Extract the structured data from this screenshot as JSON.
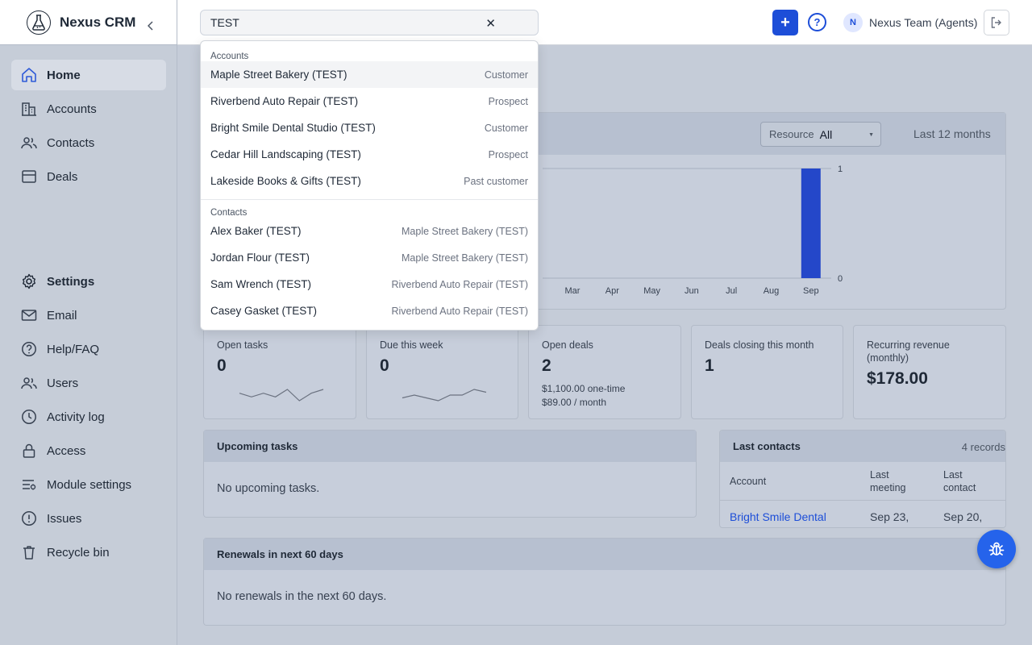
{
  "app": {
    "name": "Nexus CRM"
  },
  "topbar": {
    "search_value": "TEST",
    "clear_glyph": "✕",
    "add_glyph": "+",
    "help_glyph": "?",
    "user_initial": "N",
    "user_name": "Nexus Team (Agents)"
  },
  "sidebar": {
    "main": [
      {
        "label": "Home",
        "icon": "home-icon"
      },
      {
        "label": "Accounts",
        "icon": "building-icon"
      },
      {
        "label": "Contacts",
        "icon": "users-icon"
      },
      {
        "label": "Deals",
        "icon": "deal-icon"
      }
    ],
    "settings_label": "Settings",
    "settings": [
      {
        "label": "Email",
        "icon": "mail-icon"
      },
      {
        "label": "Help/FAQ",
        "icon": "help-icon"
      },
      {
        "label": "Users",
        "icon": "users-icon"
      },
      {
        "label": "Activity log",
        "icon": "clock-icon"
      },
      {
        "label": "Access",
        "icon": "lock-icon"
      },
      {
        "label": "Module settings",
        "icon": "sliders-icon"
      },
      {
        "label": "Issues",
        "icon": "alert-icon"
      },
      {
        "label": "Recycle bin",
        "icon": "trash-icon"
      }
    ]
  },
  "search_results": {
    "accounts_heading": "Accounts",
    "accounts": [
      {
        "name": "Maple Street Bakery (TEST)",
        "status": "Customer"
      },
      {
        "name": "Riverbend Auto Repair (TEST)",
        "status": "Prospect"
      },
      {
        "name": "Bright Smile Dental Studio (TEST)",
        "status": "Customer"
      },
      {
        "name": "Cedar Hill Landscaping (TEST)",
        "status": "Prospect"
      },
      {
        "name": "Lakeside Books & Gifts (TEST)",
        "status": "Past customer"
      }
    ],
    "contacts_heading": "Contacts",
    "contacts": [
      {
        "name": "Alex Baker (TEST)",
        "account": "Maple Street Bakery (TEST)"
      },
      {
        "name": "Jordan Flour (TEST)",
        "account": "Maple Street Bakery (TEST)"
      },
      {
        "name": "Sam Wrench (TEST)",
        "account": "Riverbend Auto Repair (TEST)"
      },
      {
        "name": "Casey Gasket (TEST)",
        "account": "Riverbend Auto Repair (TEST)"
      }
    ]
  },
  "activity_chart": {
    "resource_label": "Resource",
    "resource_value": "All",
    "range_label": "Last 12 months"
  },
  "chart_data": {
    "type": "bar",
    "categories": [
      "Mar",
      "Apr",
      "May",
      "Jun",
      "Jul",
      "Aug",
      "Sep"
    ],
    "values": [
      0,
      0,
      0,
      0,
      0,
      0,
      1
    ],
    "ylim": [
      0,
      1
    ],
    "yticks": [
      "1",
      "0"
    ],
    "bar_color": "#2447c9"
  },
  "stats": [
    {
      "label": "Open tasks",
      "value": "0",
      "spark": [
        3,
        2,
        3,
        2,
        4,
        1,
        3,
        4
      ]
    },
    {
      "label": "Due this week",
      "value": "0",
      "spark": [
        2,
        3,
        2,
        1,
        3,
        3,
        5,
        4
      ]
    },
    {
      "label": "Open deals",
      "value": "2",
      "sub1": "$1,100.00 one-time",
      "sub2": "$89.00 / month"
    },
    {
      "label": "Deals closing this month",
      "value": "1"
    },
    {
      "label": "Recurring revenue (monthly)",
      "value": "$178.00"
    }
  ],
  "upcoming": {
    "title": "Upcoming tasks",
    "empty": "No upcoming tasks."
  },
  "last_contacts": {
    "title": "Last contacts",
    "count": "4 records",
    "col_account": "Account",
    "col_meeting": "Last meeting",
    "col_contact": "Last contact",
    "row": {
      "account": "Bright Smile Dental",
      "meeting": "Sep 23,",
      "contact": "Sep 20,"
    }
  },
  "renewals": {
    "title": "Renewals in next 60 days",
    "empty": "No renewals in the next 60 days."
  },
  "colors": {
    "accent": "#1d4ed8",
    "fab": "#2563eb"
  }
}
